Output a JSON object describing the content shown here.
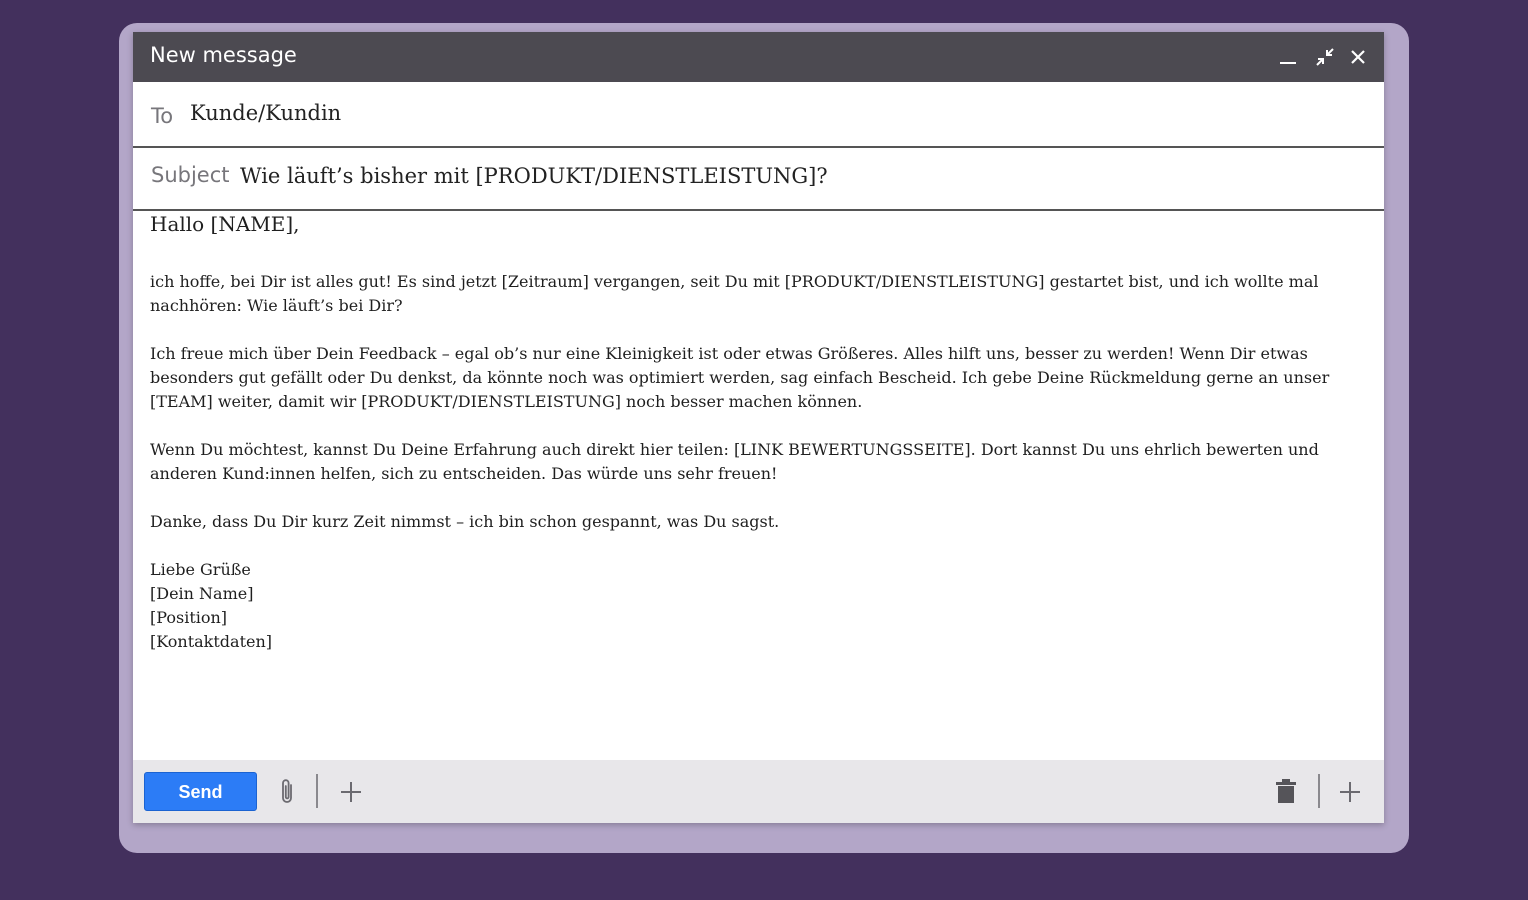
{
  "window": {
    "title": "New message",
    "controls": [
      "minimize-icon",
      "exit-fullscreen-icon",
      "close-icon"
    ]
  },
  "to": {
    "label": "To",
    "value": "Kunde/Kundin"
  },
  "subject": {
    "label": "Subject",
    "value": "Wie läuft’s bisher mit [PRODUKT/DIENSTLEISTUNG]?"
  },
  "body": {
    "greeting": "Hallo [NAME],",
    "paragraphs": [
      "ich hoffe, bei Dir ist alles gut! Es sind jetzt [Zeitraum] vergangen, seit Du mit [PRODUKT/DIENSTLEISTUNG] gestartet bist, und ich wollte mal nachhören: Wie läuft’s bei Dir?",
      "Ich freue mich über Dein Feedback – egal ob’s nur eine Kleinigkeit ist oder etwas Größeres. Alles hilft uns, besser zu werden! Wenn Dir etwas besonders gut gefällt oder Du denkst, da könnte noch was optimiert werden, sag einfach Bescheid. Ich gebe Deine Rückmeldung gerne an unser [TEAM] weiter, damit wir [PRODUKT/DIENSTLEISTUNG] noch besser machen können.",
      "Wenn Du möchtest, kannst Du Deine Erfahrung auch direkt hier teilen: [LINK BEWERTUNGSSEITE]. Dort kannst Du uns ehrlich bewerten und anderen Kund:innen helfen, sich zu entscheiden. Das würde uns sehr freuen!",
      "Danke, dass Du Dir kurz Zeit nimmst – ich bin schon gespannt, was Du sagst."
    ],
    "signature": [
      "Liebe Grüße",
      "[Dein Name]",
      "[Position]",
      "[Kontaktdaten]"
    ]
  },
  "toolbar": {
    "send_label": "Send",
    "left_icons": [
      "paperclip-icon",
      "plus-icon"
    ],
    "right_icons": [
      "trash-icon",
      "plus-icon"
    ],
    "send_color": "#2c7cf6"
  },
  "colors": {
    "background": "#43305d",
    "frame": "#b3a6c8",
    "titlebar": "#4c4a51"
  }
}
